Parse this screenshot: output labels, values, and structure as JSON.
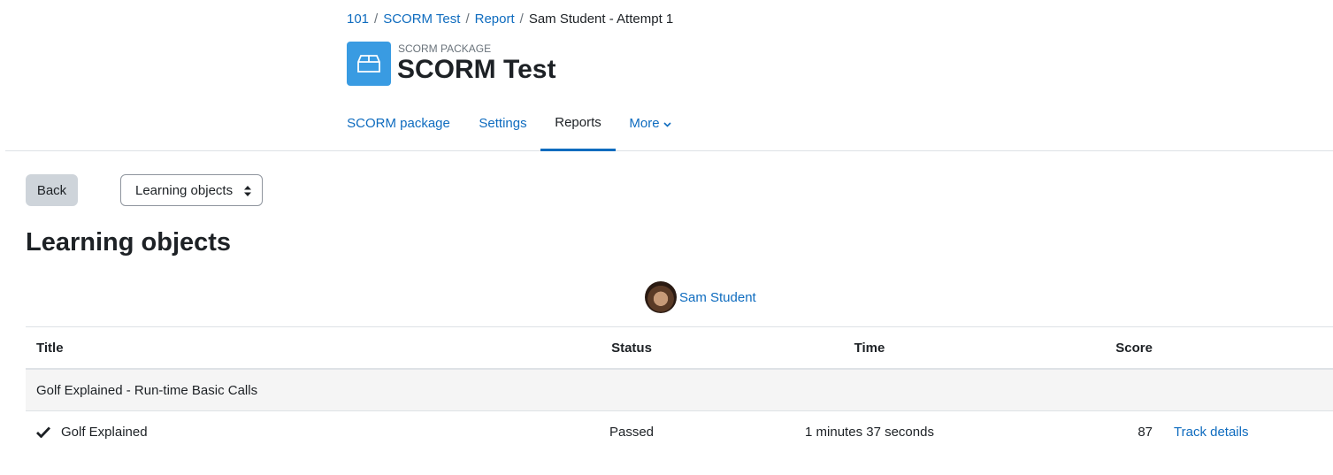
{
  "breadcrumb": {
    "items": [
      "101",
      "SCORM Test",
      "Report"
    ],
    "separator": "/",
    "current": "Sam Student - Attempt 1"
  },
  "header": {
    "kicker": "SCORM PACKAGE",
    "title": "SCORM Test",
    "icon": "package-box-icon",
    "icon_bg": "#399be2"
  },
  "secnav": {
    "tabs": [
      {
        "label": "SCORM package",
        "active": false
      },
      {
        "label": "Settings",
        "active": false
      },
      {
        "label": "Reports",
        "active": true
      },
      {
        "label": "More",
        "active": false
      }
    ]
  },
  "actions": {
    "back_label": "Back",
    "report_select_value": "Learning objects"
  },
  "section_title": "Learning objects",
  "user": {
    "name": "Sam Student"
  },
  "table": {
    "headers": {
      "title": "Title",
      "status": "Status",
      "time": "Time",
      "score": "Score"
    },
    "group": "Golf Explained - Run-time Basic Calls",
    "rows": [
      {
        "title": "Golf Explained",
        "status": "Passed",
        "time": "1 minutes 37 seconds",
        "score": "87",
        "action": "Track details"
      }
    ]
  },
  "colors": {
    "link": "#0f6cbf",
    "text": "#1d2125",
    "muted": "#6a737b",
    "border": "#dee2e6",
    "button_bg": "#ced4da"
  }
}
